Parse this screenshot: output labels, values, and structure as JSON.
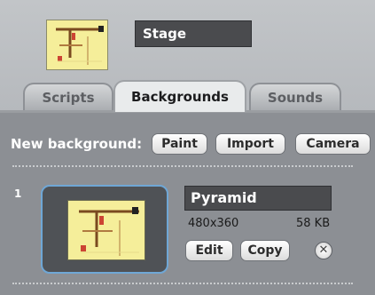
{
  "stage": {
    "name": "Stage",
    "thumbnail_icon": "stage-thumbnail"
  },
  "tabs": [
    {
      "label": "Scripts",
      "active": false
    },
    {
      "label": "Backgrounds",
      "active": true
    },
    {
      "label": "Sounds",
      "active": false
    }
  ],
  "new_background": {
    "label": "New background:",
    "buttons": {
      "paint": "Paint",
      "import": "Import",
      "camera": "Camera"
    }
  },
  "backgrounds": [
    {
      "index": "1",
      "name": "Pyramid",
      "dimensions": "480x360",
      "size": "58 KB",
      "buttons": {
        "edit": "Edit",
        "copy": "Copy",
        "delete_icon": "close-icon"
      }
    }
  ],
  "colors": {
    "thumbnail_bg": "#f5ee9a",
    "selection_border": "#6fa7d6",
    "name_field_bg": "#4a4b4e"
  }
}
